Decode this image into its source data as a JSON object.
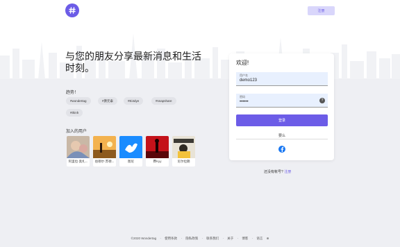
{
  "header": {
    "signup_label": "注册"
  },
  "hero": {
    "headline": "与您的朋友分享最新消息和生活时刻。"
  },
  "trending": {
    "title": "趋势！",
    "tags": [
      "#wondertag",
      "#萧元泰",
      "#Ei4dye",
      "#snapshare",
      "#thinh"
    ]
  },
  "joined": {
    "title": "加入的用户",
    "users": [
      {
        "name": "阿里拉·奥扎..."
      },
      {
        "name": "伯德尔·苏德..."
      },
      {
        "name": "图尼"
      },
      {
        "name": "賽Kyy"
      },
      {
        "name": "尼尔拉朗"
      }
    ]
  },
  "login": {
    "welcome": "欢迎!",
    "username_label": "用户名",
    "username_value": "demo123",
    "password_label": "密码",
    "password_value": "••••••",
    "login_button": "登录",
    "or_text": "要么"
  },
  "signup_prompt": {
    "text": "还没有帐号?",
    "link": "注册"
  },
  "footer": {
    "items": [
      "©2020 Wondertag",
      "使用条款",
      "隐私政策",
      "联系我们",
      "关于",
      "博客",
      "语言"
    ],
    "separator": "·"
  },
  "colors": {
    "accent": "#6c5ce7",
    "facebook": "#1877f2",
    "page_bg_lower": "#eeeff3"
  }
}
